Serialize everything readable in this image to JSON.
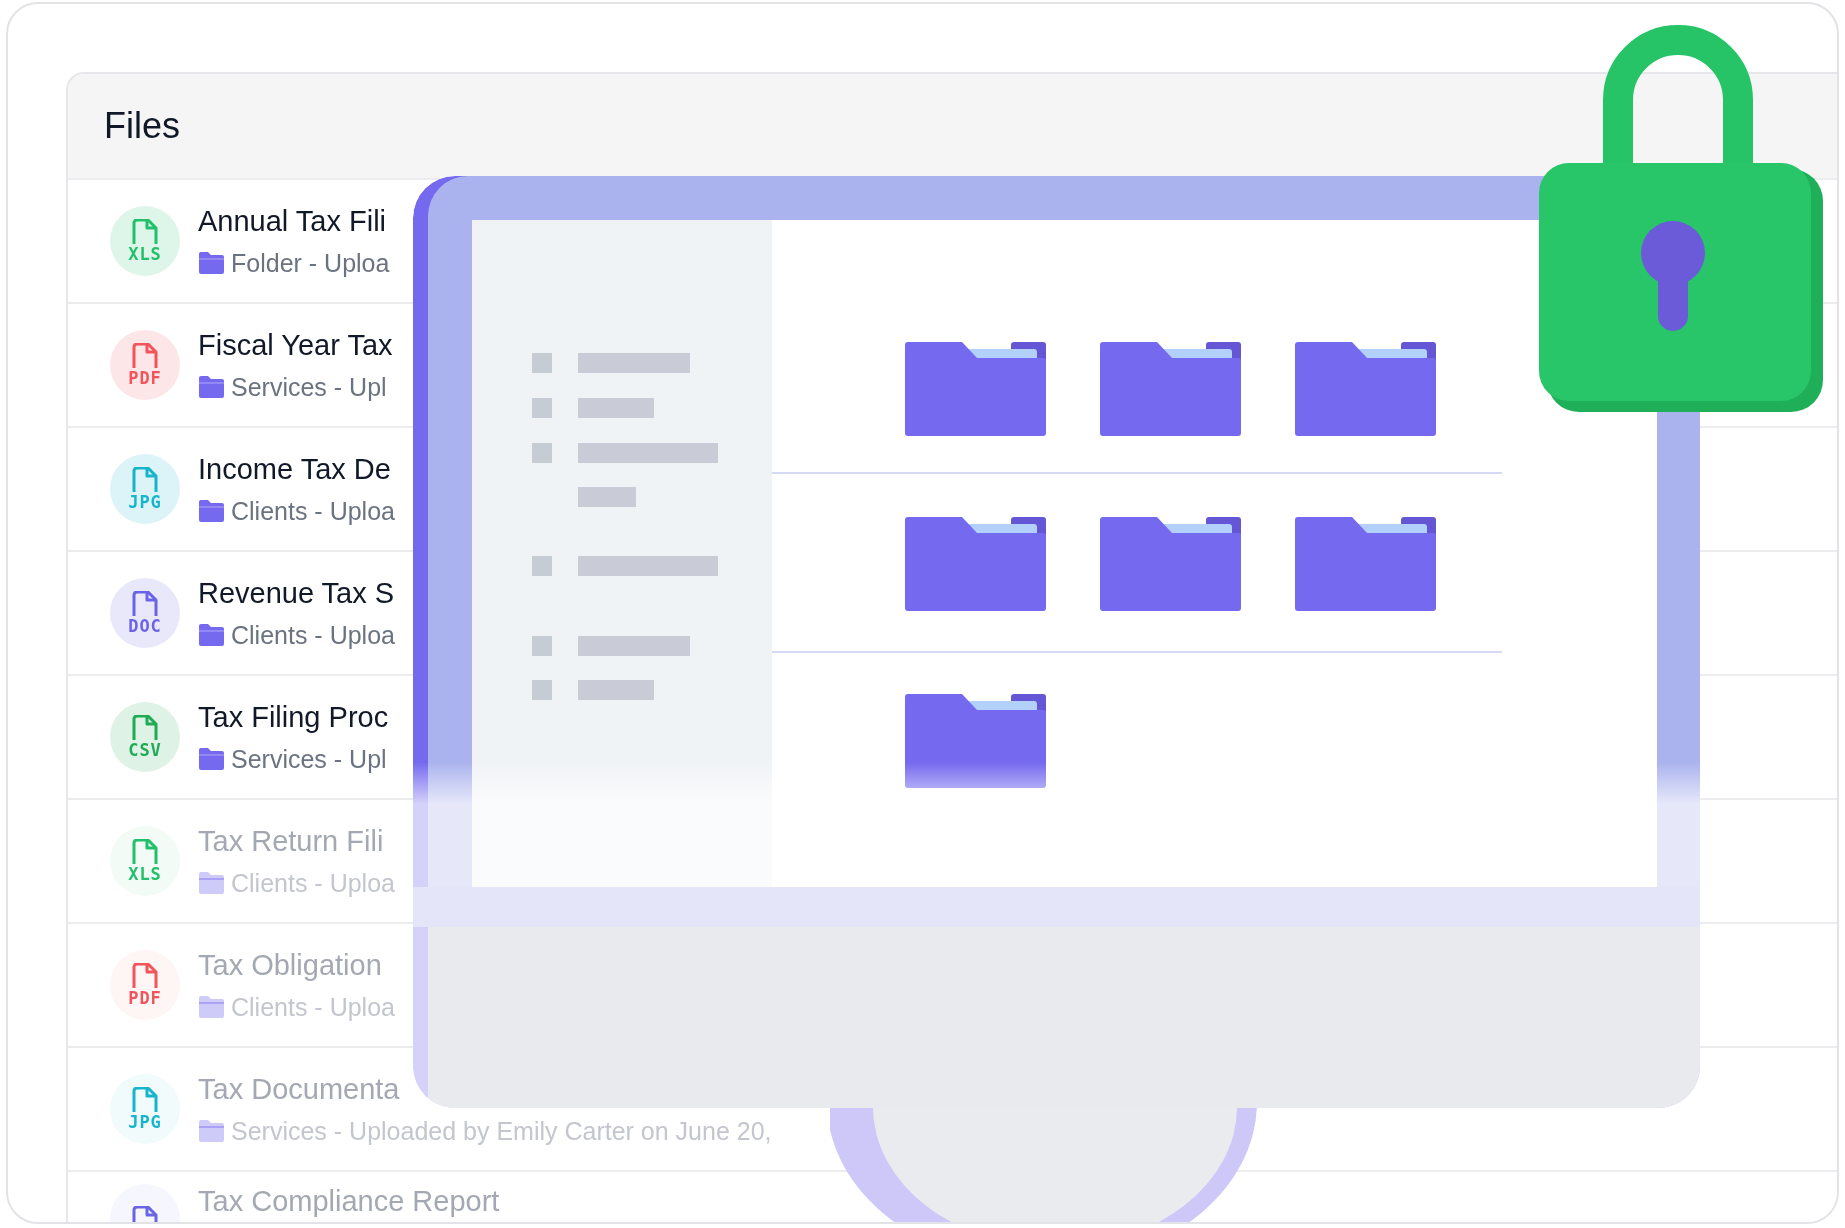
{
  "files": {
    "title": "Files",
    "rows": [
      {
        "title": "Annual Tax Fili",
        "subtitle": "Folder - Uploa",
        "type_label": "XLS",
        "color": "#22c06a",
        "faded": false
      },
      {
        "title": "Fiscal Year Tax",
        "subtitle": "Services - Upl",
        "type_label": "PDF",
        "color": "#f2545b",
        "faded": false
      },
      {
        "title": "Income Tax De",
        "subtitle": "Clients - Uploa",
        "type_label": "JPG",
        "color": "#17b4cc",
        "faded": false
      },
      {
        "title": "Revenue Tax S",
        "subtitle": "Clients - Uploa",
        "type_label": "DOC",
        "color": "#6b63e6",
        "faded": false
      },
      {
        "title": "Tax Filing Proc",
        "subtitle": "Services - Upl",
        "type_label": "CSV",
        "color": "#1faa55",
        "faded": false
      },
      {
        "title": "Tax Return Fili",
        "subtitle": "Clients - Uploa",
        "type_label": "XLS",
        "color": "#22c06a",
        "faded": true
      },
      {
        "title": "Tax Obligation",
        "subtitle": "Clients - Uploa",
        "type_label": "PDF",
        "color": "#f2545b",
        "faded": true
      },
      {
        "title": "Tax Documenta",
        "subtitle": "Services - Uploaded by Emily Carter on June 20,",
        "type_label": "JPG",
        "color": "#17b4cc",
        "faded": true
      },
      {
        "title": "Tax Compliance Report",
        "color": "#6b63e6",
        "faded": true
      }
    ]
  }
}
